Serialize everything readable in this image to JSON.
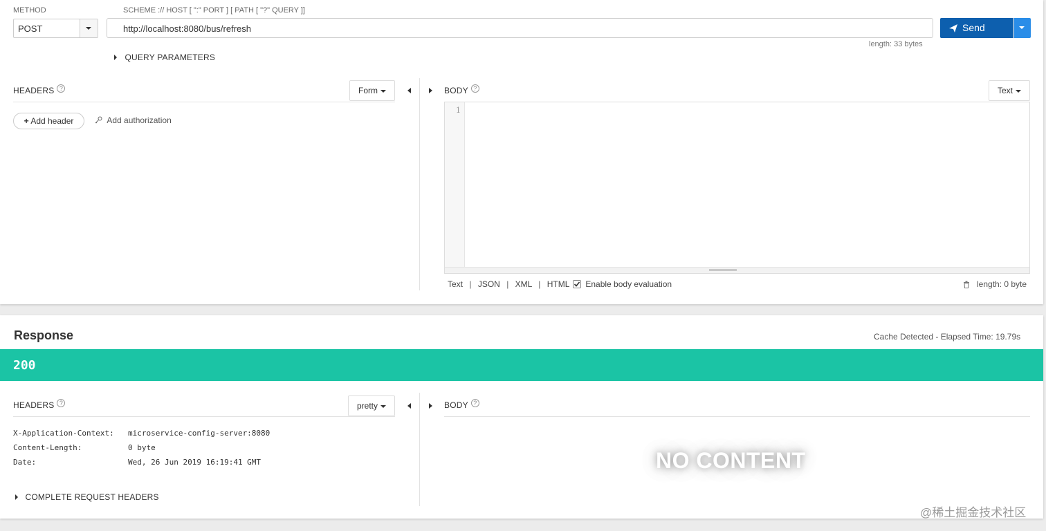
{
  "request": {
    "method_label": "METHOD",
    "method_value": "POST",
    "url_label": "SCHEME :// HOST [ \":\" PORT ] [ PATH [ \"?\" QUERY ]]",
    "url_value": "http://localhost:8080/bus/refresh",
    "url_length": "length: 33 bytes",
    "send_label": "Send",
    "query_params_label": "QUERY PARAMETERS",
    "headers_title": "HEADERS",
    "headers_mode": "Form",
    "add_header_label": "Add header",
    "add_authorization_label": "Add authorization",
    "body_title": "BODY",
    "body_mode": "Text",
    "line_number": "1",
    "format_links": [
      "Text",
      "JSON",
      "XML",
      "HTML"
    ],
    "enable_body_eval_label": "Enable body evaluation",
    "body_length": "length: 0 byte"
  },
  "response": {
    "title": "Response",
    "cache_info": "Cache Detected - Elapsed Time: 19.79s",
    "status_code": "200",
    "status_color": "#1bc4a5",
    "headers_title": "HEADERS",
    "headers_mode": "pretty",
    "body_title": "BODY",
    "headers": [
      {
        "name": "X-Application-Context:",
        "value": "microservice-config-server:8080"
      },
      {
        "name": "Content-Length:",
        "value": "0 byte"
      },
      {
        "name": "Date:",
        "value": "Wed, 26 Jun 2019 16:19:41 GMT"
      }
    ],
    "complete_headers_label": "COMPLETE REQUEST HEADERS",
    "no_content_label": "NO CONTENT"
  },
  "watermark": "@稀土掘金技术社区",
  "colors": {
    "send_button": "#0d5fae",
    "status_bar": "#1bc4a5"
  }
}
